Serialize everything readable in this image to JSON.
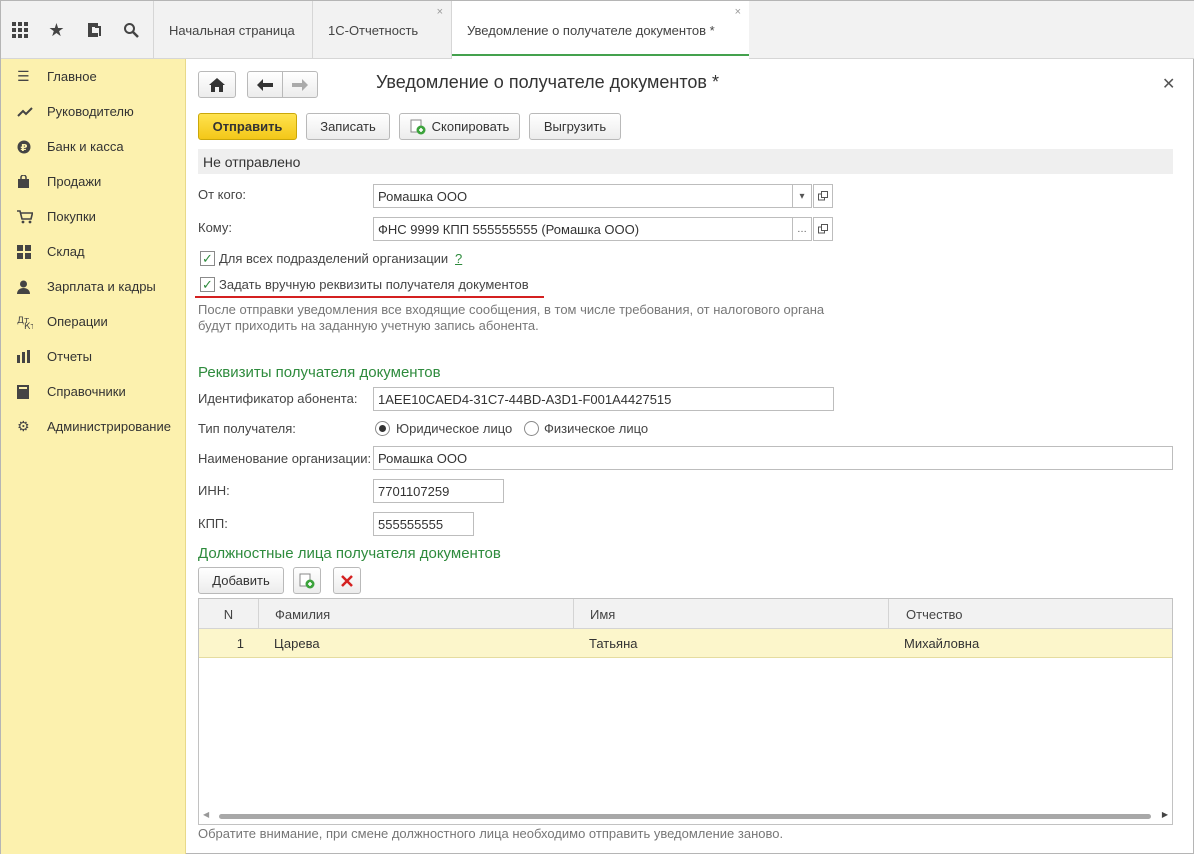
{
  "topbar": {
    "icons": [
      "apps-grid-icon",
      "star-icon",
      "history-icon",
      "search-icon"
    ],
    "tabs": [
      {
        "label": "Начальная страница"
      },
      {
        "label": "1С-Отчетность"
      },
      {
        "label": "Уведомление о получателе документов *"
      }
    ]
  },
  "sidebar": {
    "items": [
      {
        "label": "Главное",
        "icon": "menu-icon"
      },
      {
        "label": "Руководителю",
        "icon": "trend-icon"
      },
      {
        "label": "Банк и касса",
        "icon": "ruble-icon"
      },
      {
        "label": "Продажи",
        "icon": "bag-icon"
      },
      {
        "label": "Покупки",
        "icon": "cart-icon"
      },
      {
        "label": "Склад",
        "icon": "warehouse-icon"
      },
      {
        "label": "Зарплата и кадры",
        "icon": "person-icon"
      },
      {
        "label": "Операции",
        "icon": "operations-icon"
      },
      {
        "label": "Отчеты",
        "icon": "bar-chart-icon"
      },
      {
        "label": "Справочники",
        "icon": "book-icon"
      },
      {
        "label": "Администрирование",
        "icon": "gear-icon"
      }
    ]
  },
  "form": {
    "title": "Уведомление о получателе документов *",
    "buttons": {
      "send": "Отправить",
      "save": "Записать",
      "copy": "Скопировать",
      "export": "Выгрузить"
    },
    "status": "Не отправлено",
    "from_label": "От кого:",
    "from_value": "Ромашка ООО",
    "to_label": "Кому:",
    "to_value": "ФНС 9999 КПП 555555555 (Ромашка ООО)",
    "all_divisions_label": "Для всех подразделений организации",
    "help_mark": "?",
    "manual_label": "Задать вручную реквизиты получателя документов",
    "note": "После отправки уведомления все входящие сообщения, в том числе требования, от налогового органа будут приходить на заданную учетную запись абонента.",
    "section_recipient": "Реквизиты получателя документов",
    "subscriber_id_label": "Идентификатор абонента:",
    "subscriber_id_value": "1AEE10CAED4-31C7-44BD-A3D1-F001A4427515",
    "recipient_type_label": "Тип получателя:",
    "type_legal": "Юридическое лицо",
    "type_individual": "Физическое лицо",
    "org_name_label": "Наименование организации:",
    "org_name_value": "Ромашка ООО",
    "inn_label": "ИНН:",
    "inn_value": "7701107259",
    "kpp_label": "КПП:",
    "kpp_value": "555555555",
    "section_officials": "Должностные лица получателя документов",
    "add_button": "Добавить",
    "table": {
      "columns": [
        "N",
        "Фамилия",
        "Имя",
        "Отчество"
      ],
      "rows": [
        {
          "n": "1",
          "last_name": "Царева",
          "first_name": "Татьяна",
          "middle_name": "Михайловна"
        }
      ]
    },
    "footer_note": "Обратите внимание, при смене должностного лица необходимо отправить уведомление заново."
  },
  "colors": {
    "sidebar_bg": "#fcf1ae",
    "accent_green": "#2e8b3d",
    "primary_button": "#f3c718",
    "underline_red": "#d42020"
  }
}
